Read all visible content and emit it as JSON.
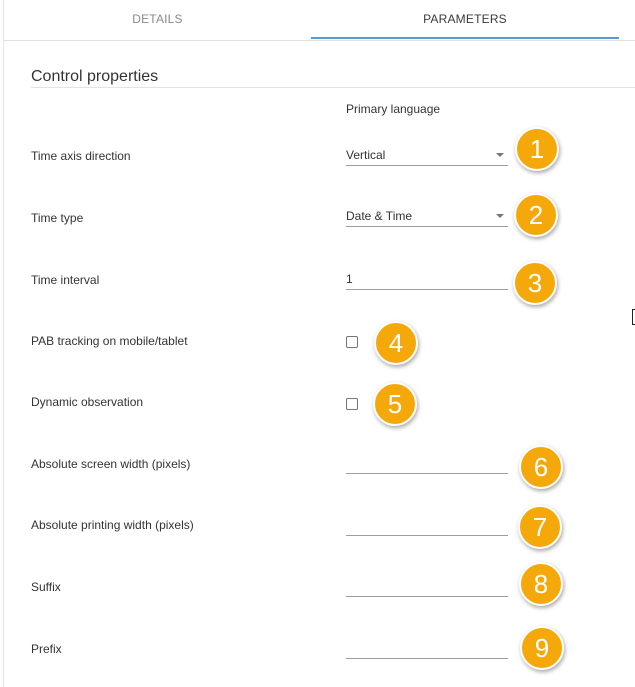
{
  "tabs": [
    {
      "label": "DETAILS"
    },
    {
      "label": "PARAMETERS"
    }
  ],
  "section": {
    "title": "Control properties",
    "column_header": "Primary language"
  },
  "fields": [
    {
      "label": "Time axis direction",
      "value": "Vertical",
      "badge": "1"
    },
    {
      "label": "Time type",
      "value": "Date & Time",
      "badge": "2"
    },
    {
      "label": "Time interval",
      "value": "1",
      "badge": "3"
    },
    {
      "label": "PAB tracking on mobile/tablet",
      "badge": "4"
    },
    {
      "label": "Dynamic observation",
      "badge": "5"
    },
    {
      "label": "Absolute screen width (pixels)",
      "value": "",
      "badge": "6"
    },
    {
      "label": "Absolute printing width (pixels)",
      "value": "",
      "badge": "7"
    },
    {
      "label": "Suffix",
      "value": "",
      "badge": "8"
    },
    {
      "label": "Prefix",
      "value": "",
      "badge": "9"
    }
  ],
  "colors": {
    "badge": "#f5a80a",
    "active_tab_underline": "#5b9bd5"
  }
}
